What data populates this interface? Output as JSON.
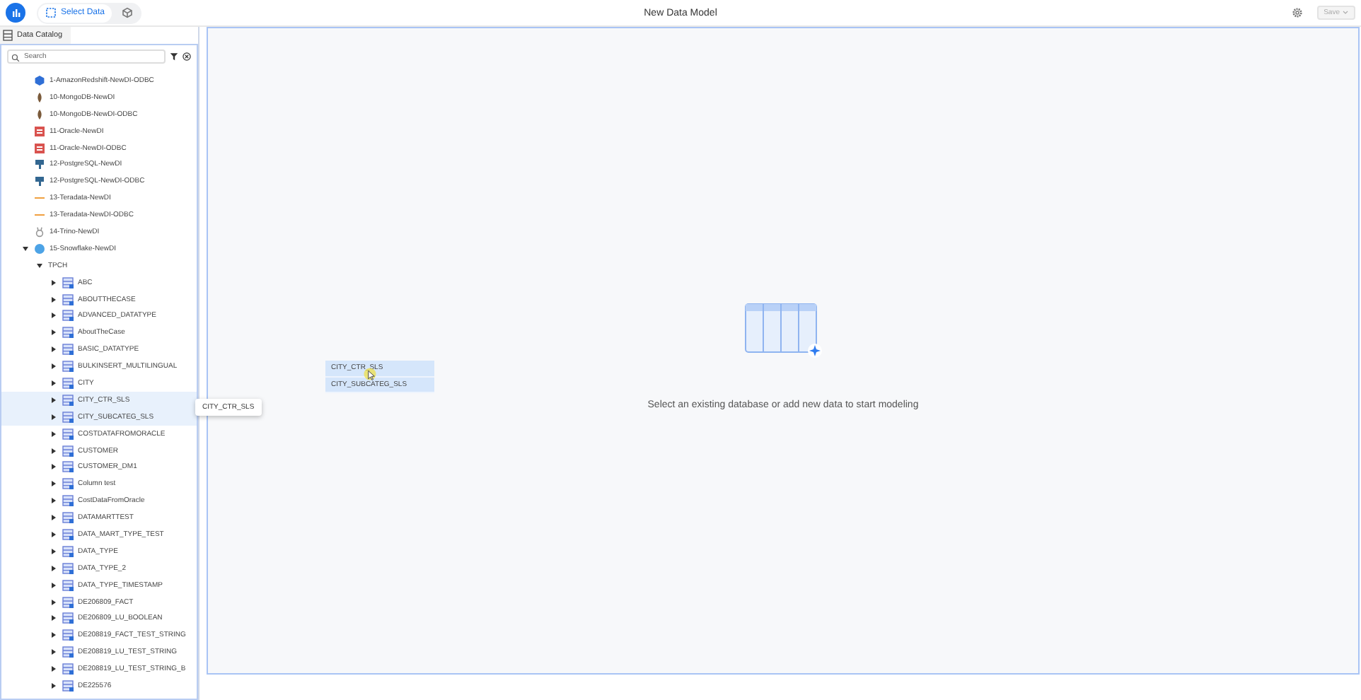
{
  "header": {
    "tabs": [
      {
        "label": "Select Data",
        "selected": true
      },
      {
        "selected": false
      }
    ],
    "title": "New Data Model",
    "save": "Save"
  },
  "catalog": {
    "title": "Data Catalog",
    "search": {
      "placeholder": "Search"
    },
    "tree": [
      {
        "label": "1-AmazonRedshift-NewDI-ODBC",
        "kind": "redshift",
        "selected": false
      },
      {
        "label": "10-MongoDB-NewDI",
        "kind": "mongodb",
        "selected": false
      },
      {
        "label": "10-MongoDB-NewDI-ODBC",
        "kind": "mongodb",
        "selected": false
      },
      {
        "label": "11-Oracle-NewDI",
        "kind": "oracle",
        "selected": false
      },
      {
        "label": "11-Oracle-NewDI-ODBC",
        "kind": "oracle",
        "selected": false
      },
      {
        "label": "12-PostgreSQL-NewDI",
        "kind": "postgres",
        "selected": false
      },
      {
        "label": "12-PostgreSQL-NewDI-ODBC",
        "kind": "postgres",
        "selected": false
      },
      {
        "label": "13-Teradata-NewDI",
        "kind": "teradata",
        "selected": false
      },
      {
        "label": "13-Teradata-NewDI-ODBC",
        "kind": "teradata",
        "selected": false
      },
      {
        "label": "14-Trino-NewDI",
        "kind": "trino",
        "selected": false
      },
      {
        "label": "15-Snowflake-NewDI",
        "kind": "snowflake",
        "selected": false,
        "expanded": true,
        "children": [
          {
            "label": "TPCH",
            "selected": false,
            "expanded": true,
            "children": [
              {
                "label": "ABC",
                "kind": "table",
                "selected": false,
                "expanded": false
              },
              {
                "label": "ABOUTTHECASE",
                "kind": "table",
                "selected": false,
                "expanded": false
              },
              {
                "label": "ADVANCED_DATATYPE",
                "kind": "table",
                "selected": false,
                "expanded": false
              },
              {
                "label": "AboutTheCase",
                "kind": "table",
                "selected": false,
                "expanded": false
              },
              {
                "label": "BASIC_DATATYPE",
                "kind": "table",
                "selected": false,
                "expanded": false
              },
              {
                "label": "BULKINSERT_MULTILINGUAL",
                "kind": "table",
                "selected": false,
                "expanded": false
              },
              {
                "label": "CITY",
                "kind": "table",
                "selected": false,
                "expanded": false
              },
              {
                "label": "CITY_CTR_SLS",
                "kind": "table",
                "selected": true,
                "expanded": false
              },
              {
                "label": "CITY_SUBCATEG_SLS",
                "kind": "table",
                "selected": true,
                "expanded": false
              },
              {
                "label": "COSTDATAFROMORACLE",
                "kind": "table",
                "selected": false,
                "expanded": false
              },
              {
                "label": "CUSTOMER",
                "kind": "table",
                "selected": false,
                "expanded": false
              },
              {
                "label": "CUSTOMER_DM1",
                "kind": "table",
                "selected": false,
                "expanded": false
              },
              {
                "label": "Column test",
                "kind": "table",
                "selected": false,
                "expanded": false
              },
              {
                "label": "CostDataFromOracle",
                "kind": "table",
                "selected": false,
                "expanded": false
              },
              {
                "label": "DATAMARTTEST",
                "kind": "table",
                "selected": false,
                "expanded": false
              },
              {
                "label": "DATA_MART_TYPE_TEST",
                "kind": "table",
                "selected": false,
                "expanded": false
              },
              {
                "label": "DATA_TYPE",
                "kind": "table",
                "selected": false,
                "expanded": false
              },
              {
                "label": "DATA_TYPE_2",
                "kind": "table",
                "selected": false,
                "expanded": false
              },
              {
                "label": "DATA_TYPE_TIMESTAMP",
                "kind": "table",
                "selected": false,
                "expanded": false
              },
              {
                "label": "DE206809_FACT",
                "kind": "table",
                "selected": false,
                "expanded": false
              },
              {
                "label": "DE206809_LU_BOOLEAN",
                "kind": "table",
                "selected": false,
                "expanded": false
              },
              {
                "label": "DE208819_FACT_TEST_STRING",
                "kind": "table",
                "selected": false,
                "expanded": false
              },
              {
                "label": "DE208819_LU_TEST_STRING",
                "kind": "table",
                "selected": false,
                "expanded": false
              },
              {
                "label": "DE208819_LU_TEST_STRING_B",
                "kind": "table",
                "selected": false,
                "expanded": false
              },
              {
                "label": "DE225576",
                "kind": "table",
                "selected": false,
                "expanded": false
              }
            ]
          }
        ]
      }
    ],
    "tooltip": "CITY_CTR_SLS"
  },
  "canvas": {
    "drag_items": [
      "CITY_CTR_SLS",
      "CITY_SUBCATEG_SLS"
    ],
    "empty_message": "Select an existing database or add new data to start modeling"
  }
}
